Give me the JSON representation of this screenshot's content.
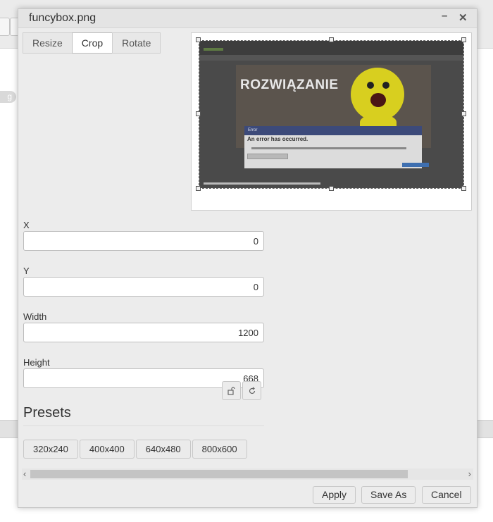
{
  "dialog": {
    "title": "funcybox.png",
    "minimize_glyph": "–",
    "close_glyph": "✕"
  },
  "tabs": [
    {
      "label": "Resize",
      "active": false
    },
    {
      "label": "Crop",
      "active": true
    },
    {
      "label": "Rotate",
      "active": false
    }
  ],
  "preview": {
    "image_text": "ROZWIĄZANIE",
    "error_header": "Error",
    "error_title": "An error has occurred."
  },
  "fields": {
    "x": {
      "label": "X",
      "value": "0"
    },
    "y": {
      "label": "Y",
      "value": "0"
    },
    "width": {
      "label": "Width",
      "value": "1200"
    },
    "height": {
      "label": "Height",
      "value": "668"
    }
  },
  "icons": {
    "lock": "lock-icon",
    "reset": "reset-icon"
  },
  "presets": {
    "title": "Presets",
    "items": [
      "320x240",
      "400x400",
      "640x480",
      "800x600"
    ]
  },
  "scrollbar": {
    "left_arrow": "‹",
    "right_arrow": "›",
    "position": 0.84
  },
  "footer": {
    "apply": "Apply",
    "save_as": "Save As",
    "cancel": "Cancel"
  },
  "background": {
    "pill_text": "g"
  }
}
